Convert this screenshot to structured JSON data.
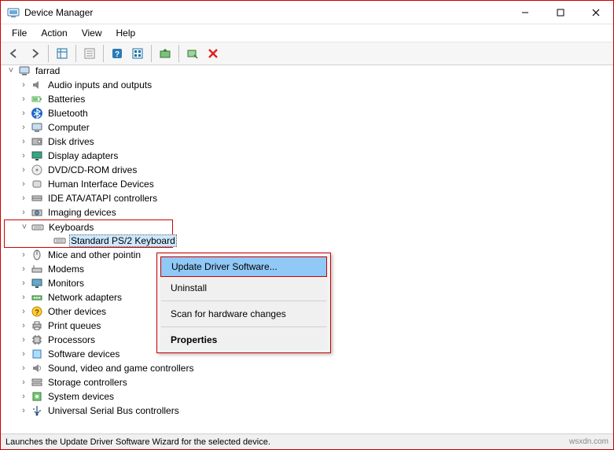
{
  "window": {
    "title": "Device Manager"
  },
  "menubar": {
    "file": "File",
    "action": "Action",
    "view": "View",
    "help": "Help"
  },
  "tree": {
    "root": "farrad",
    "items": [
      "Audio inputs and outputs",
      "Batteries",
      "Bluetooth",
      "Computer",
      "Disk drives",
      "Display adapters",
      "DVD/CD-ROM drives",
      "Human Interface Devices",
      "IDE ATA/ATAPI controllers",
      "Imaging devices",
      "Keyboards",
      "Mice and other pointin",
      "Modems",
      "Monitors",
      "Network adapters",
      "Other devices",
      "Print queues",
      "Processors",
      "Software devices",
      "Sound, video and game controllers",
      "Storage controllers",
      "System devices",
      "Universal Serial Bus controllers"
    ],
    "keyboards_child": "Standard PS/2 Keyboard"
  },
  "context_menu": {
    "update": "Update Driver Software...",
    "uninstall": "Uninstall",
    "scan": "Scan for hardware changes",
    "properties": "Properties"
  },
  "statusbar": {
    "text": "Launches the Update Driver Software Wizard for the selected device."
  },
  "watermark": "wsxdn.com"
}
